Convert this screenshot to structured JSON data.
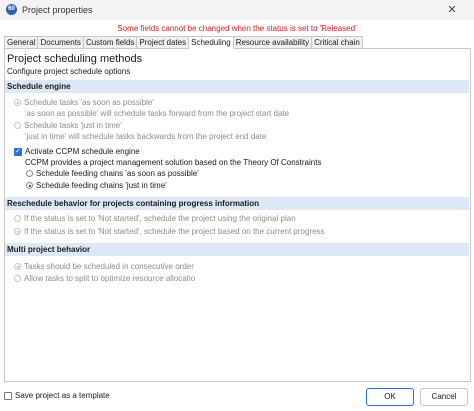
{
  "window": {
    "title": "Project properties",
    "icon_label": "60",
    "close_glyph": "✕"
  },
  "warning": "Some fields cannot be changed when the status is set to 'Released'",
  "tabs": [
    {
      "label": "General"
    },
    {
      "label": "Documents"
    },
    {
      "label": "Custom fields"
    },
    {
      "label": "Project dates"
    },
    {
      "label": "Scheduling",
      "active": true
    },
    {
      "label": "Resource availability"
    },
    {
      "label": "Critical chain"
    }
  ],
  "page": {
    "heading": "Project scheduling methods",
    "subheading": "Configure project schedule options"
  },
  "schedule_engine": {
    "title": "Schedule engine",
    "asap_label": "Schedule tasks 'as soon as possible'",
    "asap_note": "'as soon as possible' will schedule tasks forward from the project start date",
    "jit_label": "Schedule tasks 'just in time'",
    "jit_note": "'just in time' will schedule tasks backwards from the project end date",
    "ccpm_label": "Activate CCPM schedule engine",
    "ccpm_desc": "CCPM provides a project management solution based on the Theory Of Constraints",
    "feed_asap_label": "Schedule feeding chains 'as soon as possible'",
    "feed_jit_label": "Schedule feeding chains 'just in time'"
  },
  "reschedule": {
    "title": "Reschedule behavior for projects containing progress information",
    "original_label": "If the status is set to 'Not started', schedule the project using the original plan",
    "current_label": "If the status is set to 'Not started', schedule the project based on the current progress"
  },
  "multi": {
    "title": "Multi project behavior",
    "consecutive_label": "Tasks should be scheduled in consecutive order",
    "split_label": "Allow tasks to split to optimize resource allocatio"
  },
  "footer": {
    "template_label": "Save project as a template",
    "ok_label": "OK",
    "cancel_label": "Cancel"
  }
}
